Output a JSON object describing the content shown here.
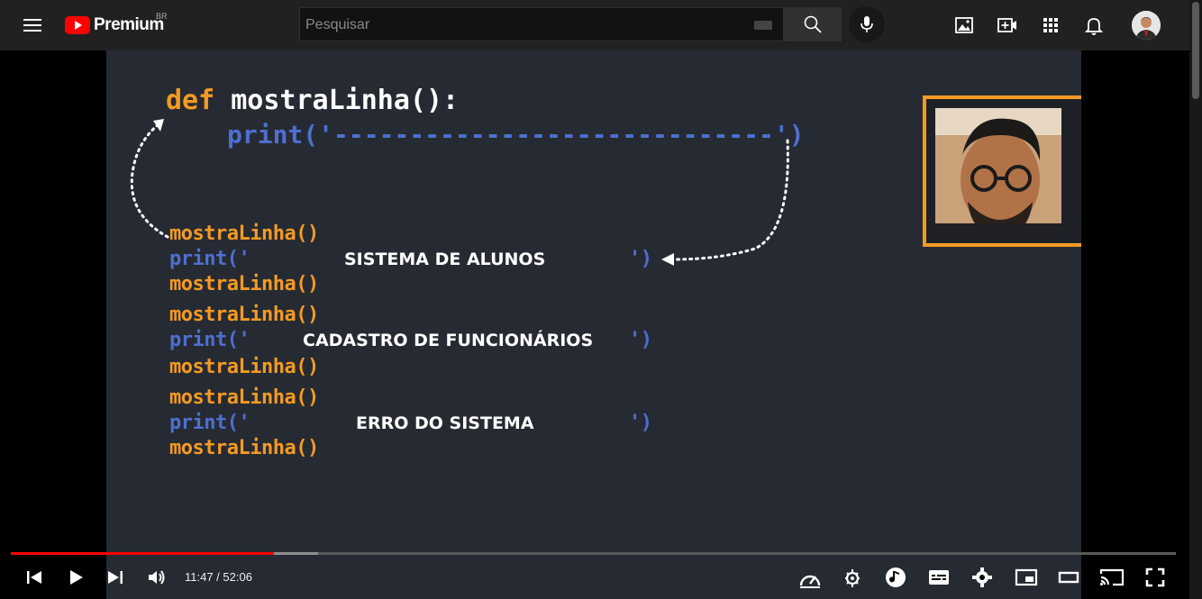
{
  "header": {
    "logo_text": "Premium",
    "country_code": "BR",
    "search_placeholder": "Pesquisar"
  },
  "video": {
    "def_keyword": "def",
    "function_def": "mostraLinha():",
    "print_dashes": "print('-----------------------------')",
    "blocks": [
      {
        "call_before": "mostraLinha()",
        "print_open": "print('",
        "message": "SISTEMA DE ALUNOS",
        "print_close": "')",
        "call_after": "mostraLinha()"
      },
      {
        "call_before": "mostraLinha()",
        "print_open": "print('",
        "message": "CADASTRO DE FUNCIONÁRIOS",
        "print_close": "')",
        "call_after": "mostraLinha()"
      },
      {
        "call_before": "mostraLinha()",
        "print_open": "print('",
        "message": "ERRO DO SISTEMA",
        "print_close": "')",
        "call_after": "mostraLinha()"
      }
    ],
    "colors": {
      "keyword_orange": "#f59a23",
      "print_blue": "#4e6fd1",
      "background": "#262b33"
    }
  },
  "player": {
    "time_display": "11:47 / 52:06",
    "played_fraction": 0.226,
    "loaded_fraction": 0.264,
    "progress_color": "#ff0000"
  },
  "icons": {
    "header": [
      "menu-icon",
      "youtube-logo-icon",
      "keyboard-icon",
      "search-icon",
      "mic-icon",
      "image-icon",
      "create-video-icon",
      "apps-icon",
      "notifications-icon"
    ],
    "player": [
      "previous-icon",
      "play-icon",
      "next-icon",
      "volume-icon",
      "playback-speed-icon",
      "autoplay-icon",
      "music-icon",
      "subtitles-icon",
      "settings-icon",
      "miniplayer-icon",
      "theater-mode-icon",
      "cast-icon",
      "fullscreen-icon"
    ]
  }
}
